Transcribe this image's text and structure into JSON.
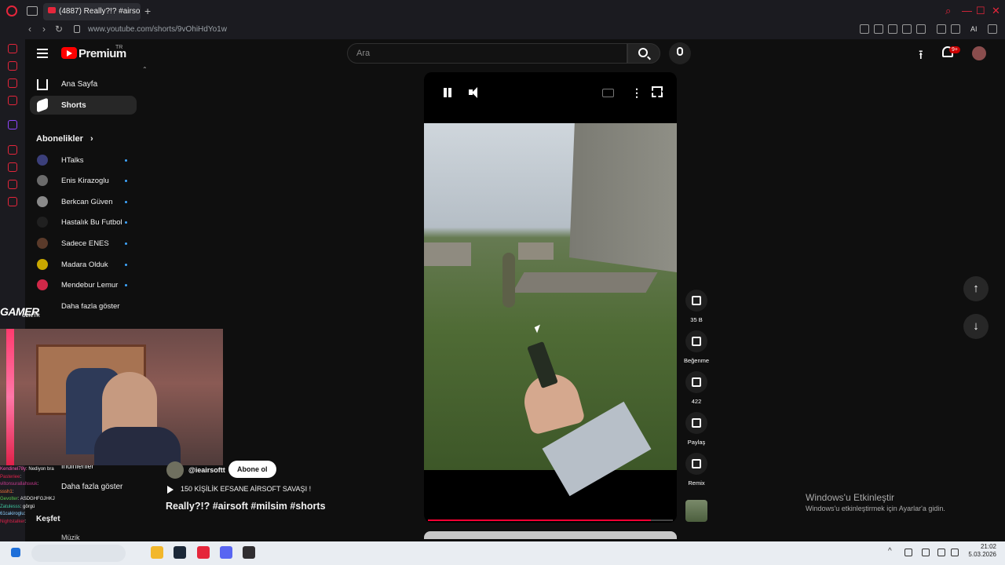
{
  "browser": {
    "tab_title": "(4887) Really?!? #airso",
    "new_tab": "+",
    "url": "www.youtube.com/shorts/9vOhiHdYo1w",
    "ai_label": "AI",
    "nav_back": "‹",
    "nav_forward": "›",
    "nav_reload": "↻",
    "window_controls": [
      "⌕",
      "—",
      "☐",
      "✕"
    ]
  },
  "header": {
    "brand": "Premium",
    "brand_region": "TR",
    "search_placeholder": "Ara",
    "upload_glyph": "⭱",
    "notifications_count": "9+"
  },
  "sidebar": {
    "collapse_glyph": "⌃",
    "items": [
      {
        "label": "Ana Sayfa"
      },
      {
        "label": "Shorts"
      }
    ],
    "subscriptions_header": "Abonelikler",
    "subscriptions_arrow": "›",
    "subscriptions": [
      {
        "label": "HTalks",
        "color": "#3b3f7a"
      },
      {
        "label": "Enis Kirazoglu",
        "color": "#6b6b6b"
      },
      {
        "label": "Berkcan Güven",
        "color": "#8a8a8a"
      },
      {
        "label": "Hastalık Bu Futbol",
        "color": "#202020"
      },
      {
        "label": "Sadece ENES",
        "color": "#5a3a2a"
      },
      {
        "label": "Madara Olduk",
        "color": "#c9a800"
      },
      {
        "label": "Mendebur Lemur",
        "color": "#d02848"
      }
    ],
    "show_more": "Daha fazla göster",
    "downloads": "İndirilenler",
    "show_more_2": "Daha fazla göster",
    "explore": "Keşfet",
    "music": "Müzik"
  },
  "overlay": {
    "gamer_logo": "GAMER",
    "gamer_sub": "GEN.TR",
    "chat": [
      {
        "user": "Kendinel78y",
        "msg": ": Nediyon bra",
        "color": "#ff5ab4"
      },
      {
        "user": "Pasteriee",
        "msg": ":",
        "color": "#e0224a"
      },
      {
        "user": "viltonsurallahsvuk",
        "msg": ":",
        "color": "#c53a8f"
      },
      {
        "user": "sssh1",
        "msg": ":",
        "color": "#ff7a3b"
      },
      {
        "user": "Gevolter",
        "msg": ": ASDGHFGJHKJ",
        "color": "#57c84d"
      },
      {
        "user": "Zatulesss",
        "msg": ": görgü",
        "color": "#3ec8a0"
      },
      {
        "user": "61cakiroglu",
        "msg": ":",
        "color": "#8bd0ff"
      },
      {
        "user": "Nightstalker",
        "msg": ": ",
        "color": "#e0224a"
      }
    ]
  },
  "player": {
    "progress": 0.91,
    "more_glyph": "⋮"
  },
  "actions": [
    {
      "name": "like",
      "label": "35 B"
    },
    {
      "name": "dislike",
      "label": "Beğenme"
    },
    {
      "name": "comments",
      "label": "422"
    },
    {
      "name": "share",
      "label": "Paylaş"
    },
    {
      "name": "remix",
      "label": "Remix"
    }
  ],
  "video_info": {
    "channel": "@ieairsoftt",
    "subscribe": "Abone ol",
    "description": "150 KİŞİLİK EFSANE AİRSOFT SAVAŞI !",
    "title": "Really?!?  #airsoft #milsim #shorts"
  },
  "nav_arrows": {
    "up": "↑",
    "down": "↓"
  },
  "windows_activation": {
    "title": "Windows'u Etkinleştir",
    "subtitle": "Windows'u etkinleştirmek için Ayarlar'a gidin."
  },
  "taskbar": {
    "time": "21:02",
    "date": "5.03.2026",
    "tray_arrow": "^",
    "apps": [
      {
        "name": "start",
        "color": "#1e6fd9"
      },
      {
        "name": "files",
        "color": "#f2b72b"
      },
      {
        "name": "steam",
        "color": "#1b2838"
      },
      {
        "name": "opera",
        "color": "#e5263b"
      },
      {
        "name": "discord",
        "color": "#5865f2"
      },
      {
        "name": "obs",
        "color": "#302e31"
      }
    ]
  }
}
